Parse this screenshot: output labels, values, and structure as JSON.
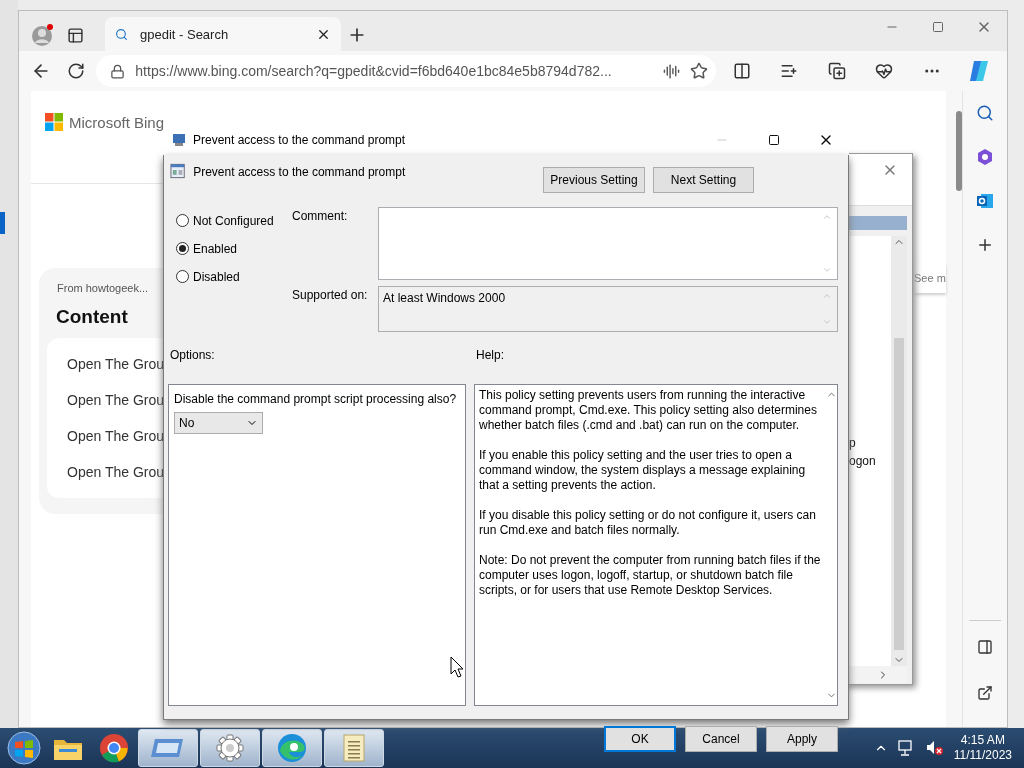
{
  "browser": {
    "tab": {
      "title": "gpedit - Search"
    },
    "address": "https://www.bing.com/search?q=gpedit&cvid=f6bd640e1bc84e5b8794d782...",
    "page": {
      "logo": "Microsoft Bing",
      "card": {
        "source": "From howtogeek...",
        "heading": "Content",
        "items": [
          "Open The Grou",
          "Open The Grou",
          "Open The Grou",
          "Open The Grou"
        ]
      },
      "see_more": "See m"
    }
  },
  "background_window": {
    "rows": [
      "p",
      "ogon"
    ]
  },
  "dialog": {
    "title": "Prevent access to the command prompt",
    "heading": "Prevent access to the command prompt",
    "nav_buttons": [
      "Previous Setting",
      "Next Setting"
    ],
    "radios": [
      {
        "label": "Not Configured",
        "selected": false
      },
      {
        "label": "Enabled",
        "selected": true
      },
      {
        "label": "Disabled",
        "selected": false
      }
    ],
    "comment_label": "Comment:",
    "supported_label": "Supported on:",
    "supported_value": "At least Windows 2000",
    "options_label": "Options:",
    "help_label": "Help:",
    "option": {
      "label": "Disable the command prompt script processing also?",
      "value": "No"
    },
    "help": [
      "This policy setting prevents users from running the interactive command prompt, Cmd.exe.  This policy setting also determines whether batch files (.cmd and .bat) can run on the computer.",
      "If you enable this policy setting and the user tries to open a command window, the system displays a message explaining that a setting prevents the action.",
      "If you disable this policy setting or do not configure it, users can run Cmd.exe and batch files normally.",
      "Note: Do not prevent the computer from running batch files if the computer uses logon, logoff, startup, or shutdown batch file scripts, or for users that use Remote Desktop Services."
    ],
    "buttons": [
      {
        "label": "OK",
        "default": true
      },
      {
        "label": "Cancel",
        "default": false
      },
      {
        "label": "Apply",
        "default": false
      }
    ]
  },
  "taskbar": {
    "apps": [
      {
        "kind": "explorer",
        "active": false
      },
      {
        "kind": "chrome",
        "active": false
      },
      {
        "kind": "group-policy",
        "active": true
      },
      {
        "kind": "settings",
        "active": true
      },
      {
        "kind": "edge",
        "active": true
      },
      {
        "kind": "notepad",
        "active": true
      }
    ],
    "clock": {
      "time": "4:15 AM",
      "date": "11/11/2023"
    }
  }
}
